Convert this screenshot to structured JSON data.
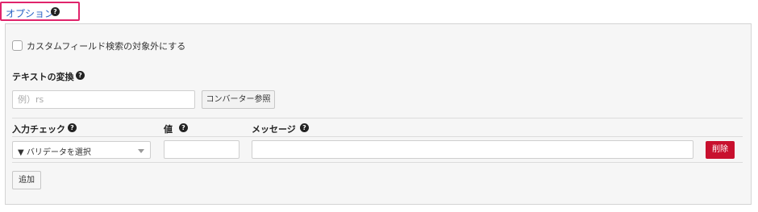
{
  "section": {
    "tab_label": "オプション",
    "help_glyph": "?"
  },
  "custom_field_search": {
    "checked": false,
    "label": "カスタムフィールド検索の対象外にする"
  },
  "text_transform": {
    "heading": "テキストの変換",
    "input_placeholder": "例）rs",
    "input_value": "",
    "converter_button_label": "コンバーター参照"
  },
  "validation": {
    "headers": {
      "input_check": "入力チェック",
      "value": "値",
      "message": "メッセージ"
    },
    "row": {
      "validator_select": "▼ バリデータを選択",
      "value": "",
      "message": ""
    },
    "delete_button_label": "削除",
    "add_button_label": "追加"
  },
  "colors": {
    "tab_border": "#e0246b",
    "tab_text": "#2a64c5",
    "delete_button": "#c8102e"
  }
}
